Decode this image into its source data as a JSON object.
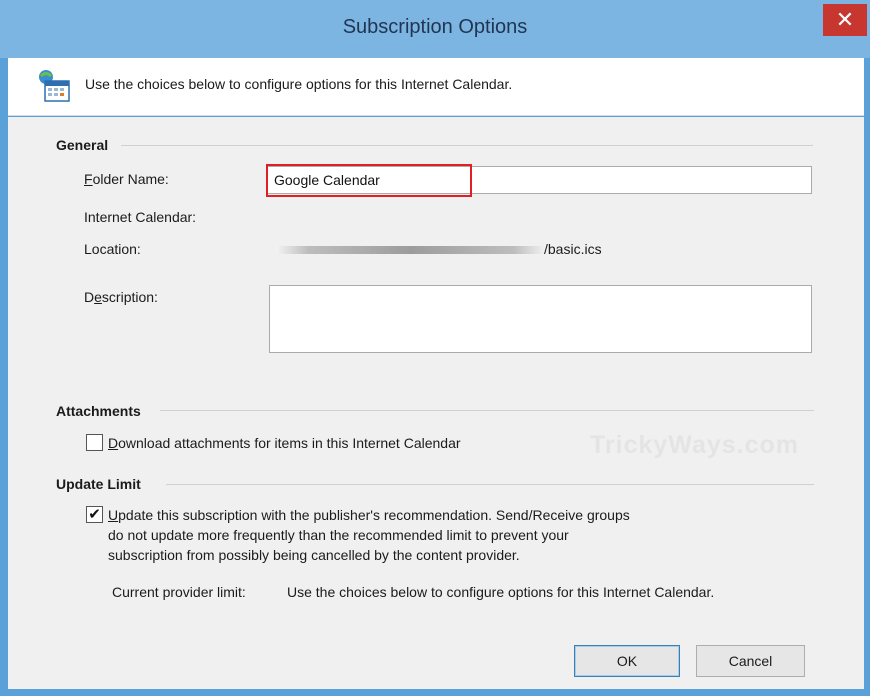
{
  "window": {
    "title": "Subscription Options",
    "close_glyph": "✕"
  },
  "header": {
    "icon": "calendar-icon",
    "text": "Use the choices below to configure options for this Internet Calendar."
  },
  "general": {
    "title": "General",
    "folder_name_label_key": "F",
    "folder_name_label_rest": "older Name:",
    "folder_name_value": "Google Calendar",
    "internet_calendar_label": "Internet Calendar:",
    "location_label": "Location:",
    "location_suffix": "/basic.ics",
    "description_label_pre": "D",
    "description_label_key": "e",
    "description_label_rest": "scription:",
    "description_value": ""
  },
  "attachments": {
    "title": "Attachments",
    "checkbox_checked": false,
    "checkbox_label_key": "D",
    "checkbox_label_rest": "ownload attachments for items in this Internet Calendar"
  },
  "update_limit": {
    "title": "Update Limit",
    "checkbox_checked": true,
    "check_glyph": "✔",
    "line1_key": "U",
    "line1_rest": "pdate this subscription with the publisher's recommendation. Send/Receive groups",
    "line2": "do not update more frequently than the recommended limit to prevent your",
    "line3": "subscription from possibly being cancelled by the content provider.",
    "current_limit_label": "Current provider limit:",
    "current_limit_value": "Use the choices below to configure options for this Internet Calendar."
  },
  "watermark": "TrickyWays.com",
  "buttons": {
    "ok": "OK",
    "cancel": "Cancel"
  },
  "colors": {
    "titlebar": "#7db5e2",
    "close": "#c7372f",
    "highlight": "#e11d26"
  }
}
